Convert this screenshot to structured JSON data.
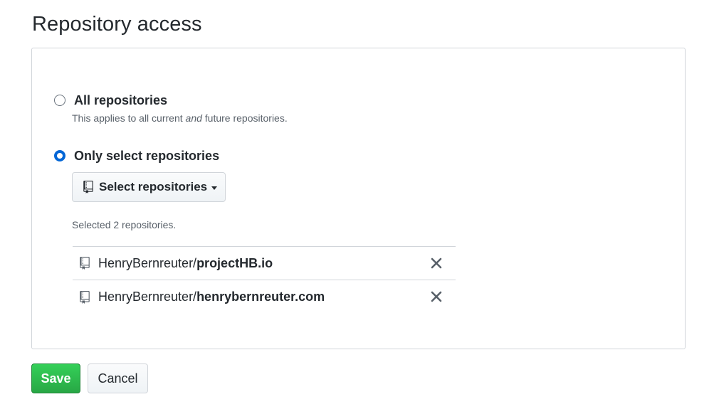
{
  "page": {
    "title": "Repository access"
  },
  "options": {
    "all": {
      "label": "All repositories",
      "note_before": "This applies to all current ",
      "note_em": "and",
      "note_after": " future repositories.",
      "checked": false
    },
    "select": {
      "label": "Only select repositories",
      "checked": true,
      "button_label": "Select repositories",
      "selected_text": "Selected 2 repositories."
    }
  },
  "repositories": [
    {
      "owner": "HenryBernreuter/",
      "name": "projectHB.io"
    },
    {
      "owner": "HenryBernreuter/",
      "name": "henrybernreuter.com"
    }
  ],
  "actions": {
    "save_label": "Save",
    "cancel_label": "Cancel"
  },
  "colors": {
    "primary_green": "#28a745",
    "radio_blue": "#0366d6",
    "border": "#d1d5da"
  },
  "icons": {
    "repo": "repo-icon",
    "remove": "close-icon",
    "dropdown": "caret-down-icon"
  }
}
